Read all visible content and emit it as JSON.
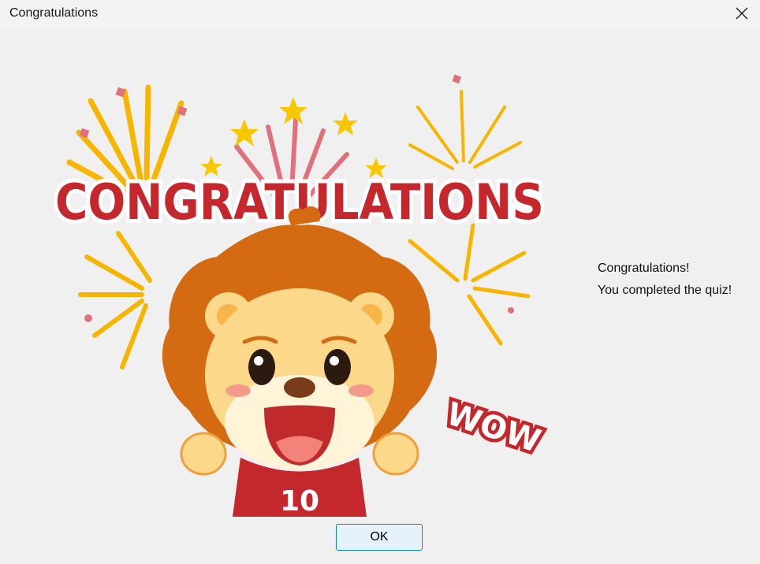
{
  "window": {
    "title": "Congratulations"
  },
  "illustration": {
    "banner_text": "CONGRATULATIONS",
    "jersey_number": "10",
    "wow_text": "WOW"
  },
  "message": {
    "line1": "Congratulations!",
    "line2": "You completed the quiz!"
  },
  "buttons": {
    "ok_label": "OK"
  },
  "colors": {
    "banner_red": "#c4282c",
    "mane_orange": "#d46a12",
    "face_yellow": "#fcd88a",
    "firework_yellow": "#f7b500",
    "firework_pink": "#e0707a",
    "button_bg": "#e5f1fb",
    "button_border": "#0078d4"
  }
}
